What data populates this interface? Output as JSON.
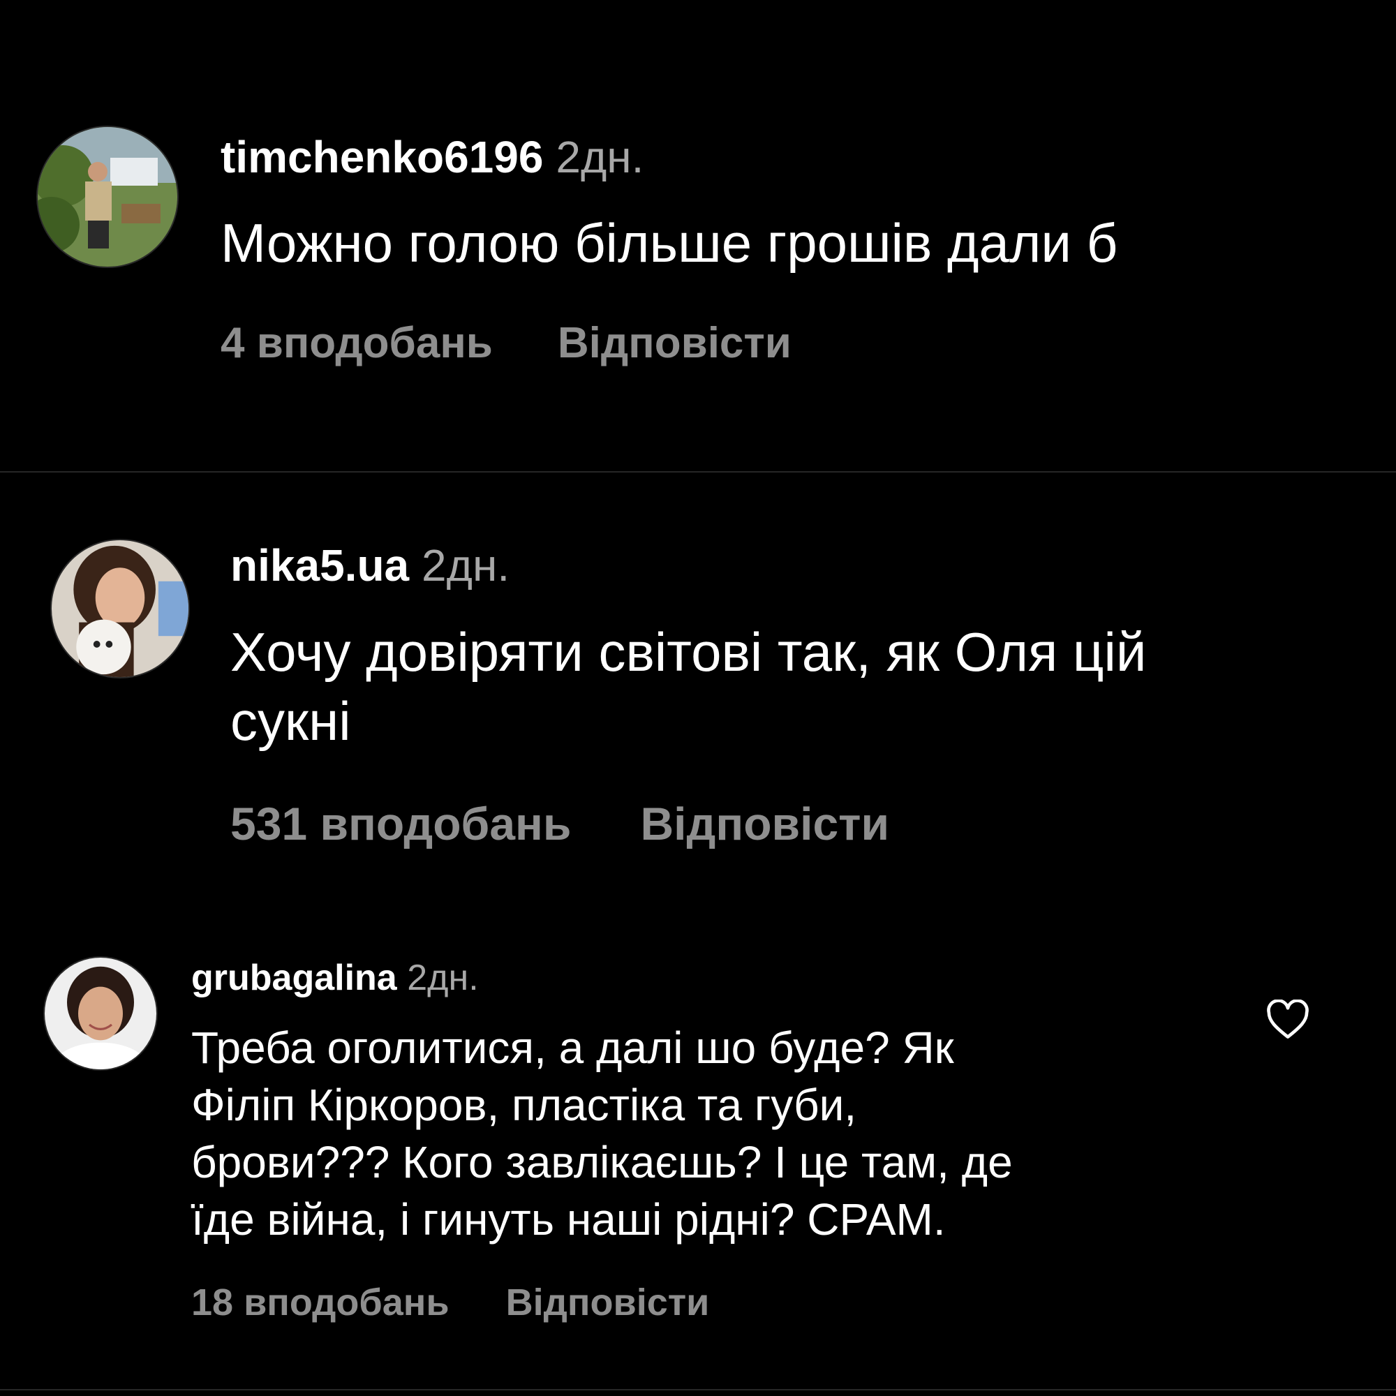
{
  "comments": [
    {
      "username": "timchenko6196",
      "time": "2дн.",
      "text": "Можно голою більше грошів дали  б",
      "likes": "4 вподобань",
      "reply": "Відповісти"
    },
    {
      "username": "nika5.ua",
      "time": "2дн.",
      "text": "Хочу довіряти світові так, як Оля цій\nсукні",
      "likes": "531 вподобань",
      "reply": "Відповісти"
    },
    {
      "username": "grubagalina",
      "time": "2дн.",
      "text": "Треба оголитися, а далі шо буде? Як\nФіліп Кіркоров, пластіка та губи,\nброви??? Кого завлікаєшь? І це там, де\nїде війна, і гинуть наші рідні? СРАМ.",
      "likes": "18 вподобань",
      "reply": "Відповісти"
    }
  ],
  "icons": {
    "like": "heart-outline-icon"
  },
  "colors": {
    "background": "#000000",
    "text": "#ffffff",
    "secondary": "#a8a8a8",
    "actions": "#8e8e8e"
  }
}
